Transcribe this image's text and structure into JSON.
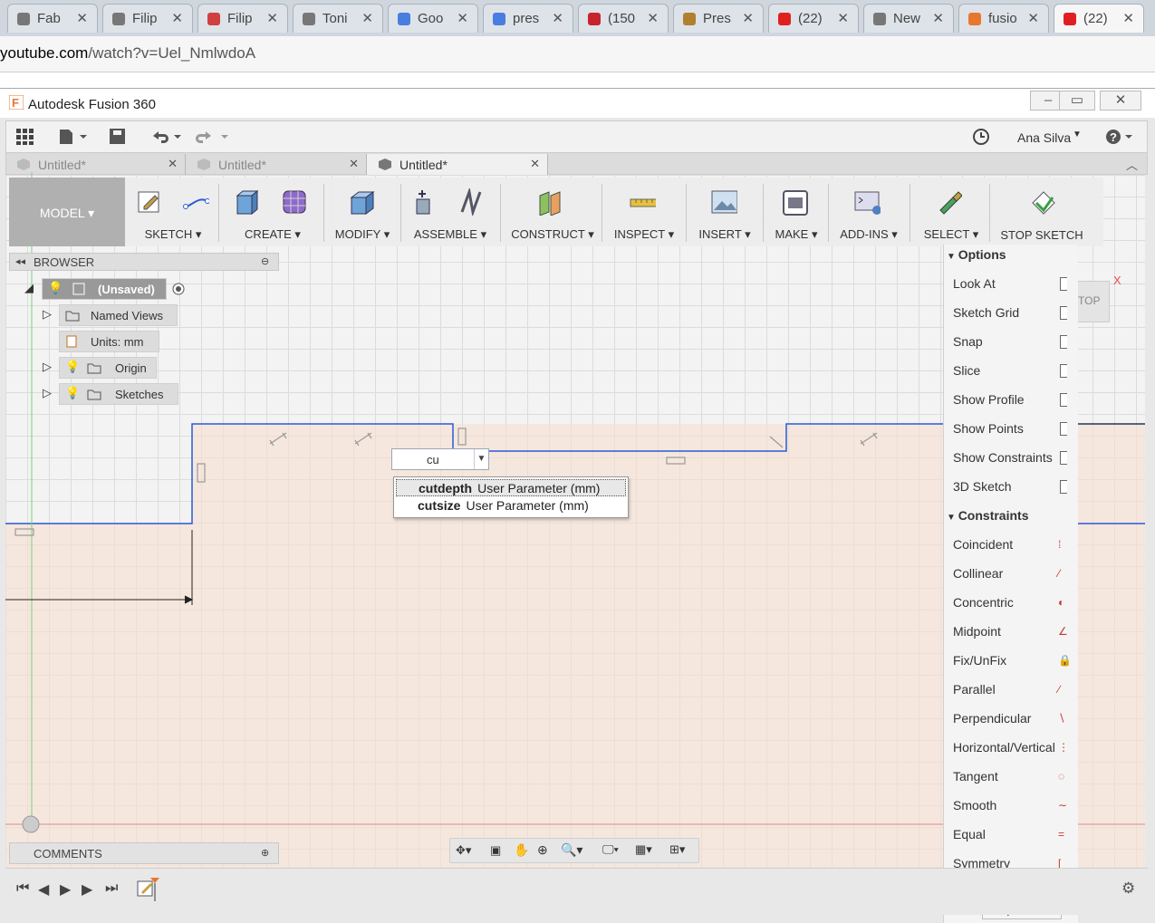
{
  "browser": {
    "tabs": [
      {
        "label": "Fab",
        "icon": "document-icon"
      },
      {
        "label": "Filip",
        "icon": "document-icon"
      },
      {
        "label": "Filip",
        "icon": "pinwheel-icon"
      },
      {
        "label": "Toni",
        "icon": "document-icon"
      },
      {
        "label": "Goo",
        "icon": "translate-icon"
      },
      {
        "label": "pres",
        "icon": "google-icon"
      },
      {
        "label": "(150",
        "icon": "pinterest-icon"
      },
      {
        "label": "Pres",
        "icon": "presenter-icon"
      },
      {
        "label": "(22)",
        "icon": "youtube-icon"
      },
      {
        "label": "New",
        "icon": "apps-icon"
      },
      {
        "label": "fusio",
        "icon": "fusion-icon"
      },
      {
        "label": "(22)",
        "icon": "youtube-icon"
      }
    ],
    "url_domain": "youtube.com",
    "url_path": "/watch?v=Uel_NmlwdoA"
  },
  "app": {
    "title": "Autodesk Fusion 360",
    "user": "Ana Silva",
    "doc_tabs": [
      "Untitled*",
      "Untitled*",
      "Untitled*"
    ],
    "workspace": "MODEL ▾",
    "toolbar": [
      {
        "label": "SKETCH ▾"
      },
      {
        "label": "CREATE ▾"
      },
      {
        "label": "MODIFY ▾"
      },
      {
        "label": "ASSEMBLE ▾"
      },
      {
        "label": "CONSTRUCT ▾"
      },
      {
        "label": "INSPECT ▾"
      },
      {
        "label": "INSERT ▾"
      },
      {
        "label": "MAKE ▾"
      },
      {
        "label": "ADD-INS ▾"
      },
      {
        "label": "SELECT ▾"
      },
      {
        "label": "STOP SKETCH"
      }
    ]
  },
  "browser_panel": {
    "title": "BROWSER",
    "root": "(Unsaved)",
    "items": [
      "Named Views",
      "Units: mm",
      "Origin",
      "Sketches"
    ]
  },
  "dimension": {
    "input_value": "cu",
    "suggestions": [
      {
        "name": "cutdepth",
        "desc": "User Parameter (mm)"
      },
      {
        "name": "cutsize",
        "desc": "User Parameter (mm)"
      }
    ]
  },
  "view_cube": "TOP",
  "palette": {
    "options_title": "Options",
    "options": [
      "Look At",
      "Sketch Grid",
      "Snap",
      "Slice",
      "Show Profile",
      "Show Points",
      "Show Constraints",
      "3D Sketch"
    ],
    "constraints_title": "Constraints",
    "constraints": [
      "Coincident",
      "Collinear",
      "Concentric",
      "Midpoint",
      "Fix/UnFix",
      "Parallel",
      "Perpendicular",
      "Horizontal/Vertical",
      "Tangent",
      "Smooth",
      "Equal",
      "Symmetry"
    ],
    "stop_button": "Stop Sketch"
  },
  "comments": "COMMENTS",
  "colors": {
    "sketch_line": "#2a5bd7",
    "profile_fill": "#f6e0ce",
    "model_button": "#b0b0b0"
  }
}
